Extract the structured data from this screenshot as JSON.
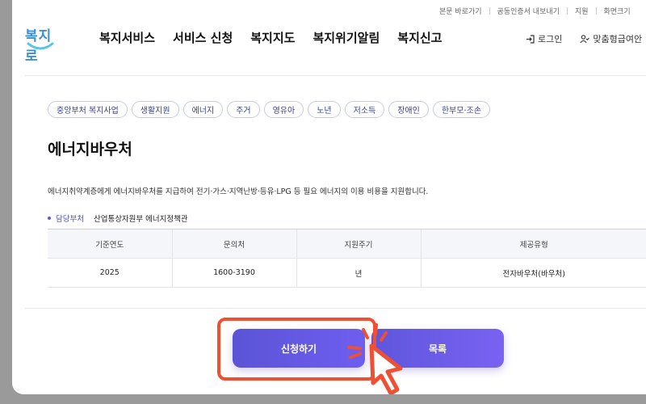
{
  "utility_bar": [
    "본문 바로가기",
    "공동인증서 내보내기",
    "지원",
    "화면크기"
  ],
  "logo_text": "복지로",
  "nav": [
    "복지서비스",
    "서비스 신청",
    "복지지도",
    "복지위기알림",
    "복지신고"
  ],
  "header_links": {
    "login": "로그인",
    "custom": "맞춤형급여안"
  },
  "tags": [
    "중앙부처 복지사업",
    "생활지원",
    "에너지",
    "주거",
    "영유아",
    "노년",
    "저소득",
    "장애인",
    "한부모·조손"
  ],
  "service": {
    "title": "에너지바우처",
    "description": "에너지취약계층에게 에너지바우처를 지급하여 전기·가스·지역난방·등유·LPG 등 필요 에너지의 이용 비용을 지원합니다.",
    "dept_label": "담당부처",
    "dept_value": "산업통상자원부 에너지정책관"
  },
  "table": {
    "headers": [
      "기준연도",
      "문의처",
      "지원주기",
      "제공유형"
    ],
    "rows": [
      [
        "2025",
        "1600-3190",
        "년",
        "전자바우처(바우처)"
      ]
    ]
  },
  "buttons": {
    "apply": "신청하기",
    "list": "목록"
  },
  "colors": {
    "accent": "#5b54d6",
    "highlight": "#ee5033",
    "tag_text": "#3a3f84"
  }
}
